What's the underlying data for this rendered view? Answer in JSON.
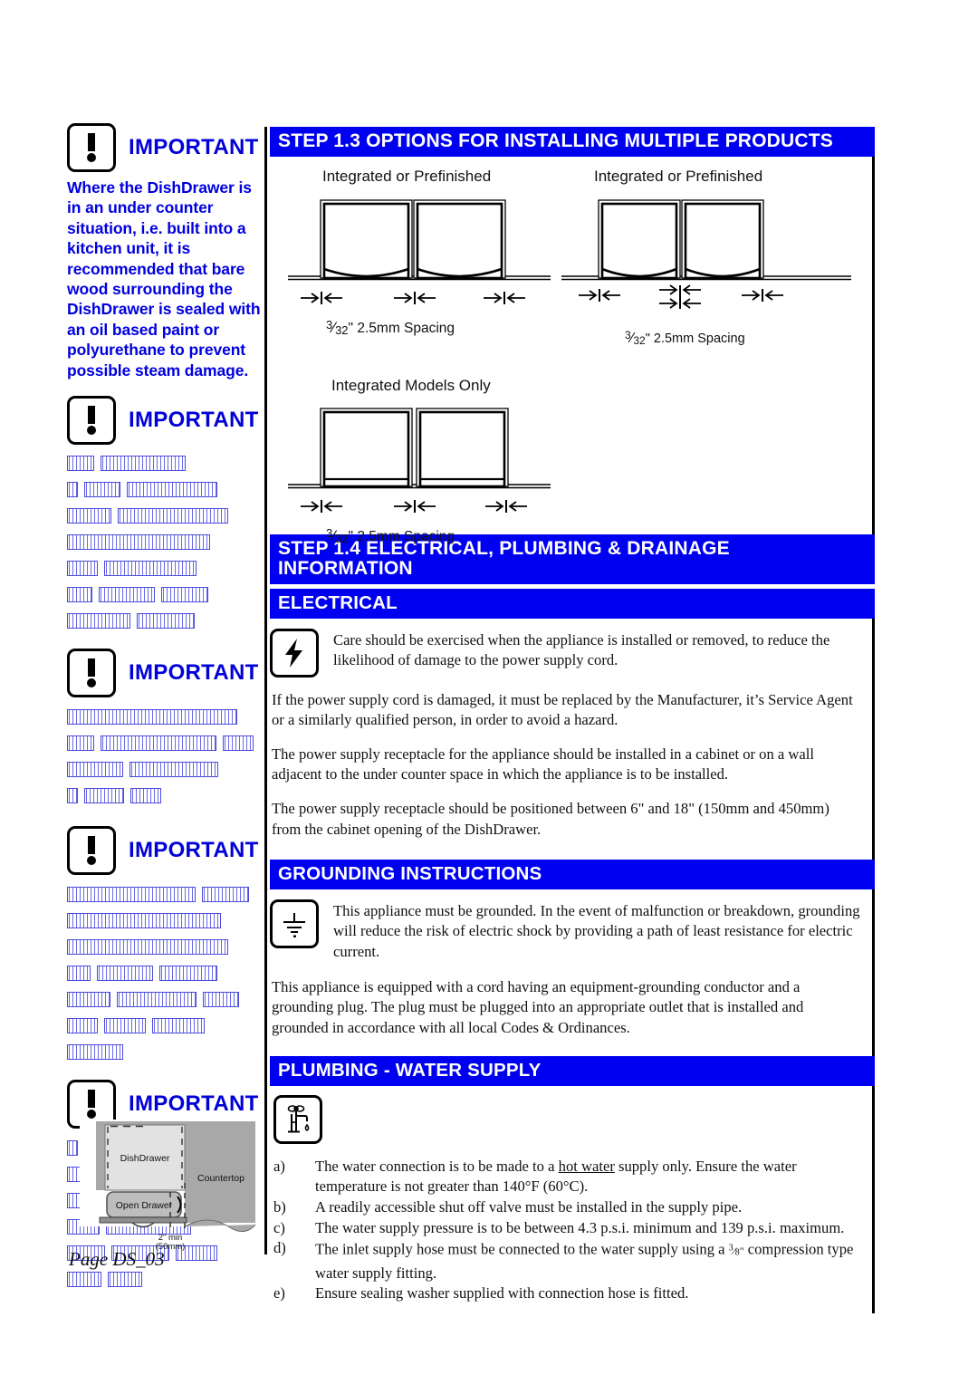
{
  "important_blocks": [
    {
      "icon": "exclamation-icon",
      "title": "IMPORTANT",
      "readable": true,
      "text": "Where the DishDrawer is in an under counter situation, i.e. built into a kitchen unit, it is recommended that bare wood surrounding the DishDrawer is sealed with an oil based paint or polyurethane to prevent possible steam damage."
    },
    {
      "icon": "exclamation-icon",
      "title": "IMPORTANT",
      "readable": false,
      "redacted_lines": [
        [
          28,
          92
        ],
        [
          10,
          38,
          98
        ],
        [
          47,
          120
        ],
        [
          156
        ],
        [
          32,
          100
        ],
        [
          26,
          60,
          50
        ],
        [
          68,
          62
        ]
      ]
    },
    {
      "icon": "exclamation-icon",
      "title": "IMPORTANT",
      "readable": false,
      "redacted_lines": [
        [
          186
        ],
        [
          28,
          126,
          32
        ],
        [
          60,
          96
        ],
        [
          10,
          42,
          32
        ]
      ]
    },
    {
      "icon": "exclamation-icon",
      "title": "IMPORTANT",
      "readable": false,
      "redacted_lines": [
        [
          140,
          50
        ],
        [
          168
        ],
        [
          176
        ],
        [
          24,
          60,
          62
        ],
        [
          46,
          86,
          38
        ],
        [
          32,
          44,
          56
        ],
        [
          60
        ]
      ]
    },
    {
      "icon": "exclamation-icon",
      "title": "IMPORTANT",
      "readable": false,
      "redacted_lines": [
        [
          10,
          148
        ],
        [
          168
        ],
        [
          66,
          12,
          34,
          34,
          22
        ],
        [
          34,
          92
        ],
        [
          40,
          62,
          44
        ],
        [
          36,
          36
        ]
      ]
    }
  ],
  "step_1_3": {
    "heading": "STEP  1.3  OPTIONS FOR INSTALLING MULTIPLE PRODUCTS",
    "diagram_a": {
      "label": "Integrated or Prefinished",
      "spacing_num": "3",
      "spacing_den": "32",
      "spacing_text": "\" 2.5mm Spacing"
    },
    "diagram_b": {
      "label": "Integrated or Prefinished",
      "spacing_num": "3",
      "spacing_den": "32",
      "spacing_text": "\" 2.5mm Spacing"
    },
    "diagram_c": {
      "label": "Integrated Models Only",
      "spacing_num": "3",
      "spacing_den": "32",
      "spacing_text": "\" 2.5mm Spacing"
    }
  },
  "step_1_4": {
    "heading": "STEP  1.4  ELECTRICAL, PLUMBING & DRAINAGE INFORMATION",
    "electrical": {
      "heading": "ELECTRICAL",
      "icon": "lightning-bolt-icon",
      "icon_paragraph": "Care should be exercised when the appliance is installed or removed, to reduce the likelihood of damage to the power supply cord.",
      "paragraphs": [
        "If the power supply cord is damaged, it must be replaced by the Manufacturer, it’s Service Agent or a similarly qualified person, in order to avoid a hazard.",
        "The power supply receptacle for the appliance should be installed in a cabinet or on a wall adjacent to the under counter space in which the appliance is to be installed.",
        "The power supply receptacle should be positioned between 6\" and 18\" (150mm and 450mm) from the cabinet opening of the DishDrawer."
      ]
    },
    "grounding": {
      "heading": "GROUNDING  INSTRUCTIONS",
      "icon": "earth-ground-icon",
      "icon_paragraph": "This appliance must be grounded.  In the event of malfunction or breakdown, grounding will reduce the risk of electric shock by providing a path of least resistance for electric current.",
      "paragraphs": [
        "This appliance is equipped with a cord having an equipment-grounding conductor and a grounding plug.  The plug must be plugged into an appropriate outlet that is installed and grounded in accordance with all local Codes & Ordinances."
      ]
    },
    "plumbing": {
      "heading": "PLUMBING  -  WATER  SUPPLY",
      "icon": "faucet-icon",
      "items": [
        {
          "marker": "a)",
          "pre": "The water connection is to be made to a ",
          "underline": "hot water",
          "post": " supply only.  Ensure the water temperature is not greater than 140°F (60°C)."
        },
        {
          "marker": "b)",
          "pre": "A readily accessible shut off valve must be installed in the supply pipe.",
          "underline": "",
          "post": ""
        },
        {
          "marker": "c)",
          "pre": "The water supply pressure is to be between 4.3 p.s.i.  minimum and 139 p.s.i. maximum.",
          "underline": "",
          "post": ""
        },
        {
          "marker": "d)",
          "pre": "The inlet supply hose must be connected to the water supply using a ",
          "underline": "",
          "post": " compression type water supply fitting.",
          "fraction": "3/8\""
        },
        {
          "marker": "e)",
          "pre": "Ensure sealing washer supplied with connection hose is fitted.",
          "underline": "",
          "post": ""
        }
      ]
    }
  },
  "bottom_diagram": {
    "dishdrawer_label": "DishDrawer",
    "countertop_label": "Countertop",
    "open_drawer_label": "Open Drawer",
    "dimension_line1": "2\" min",
    "dimension_line2": "(50mm)"
  },
  "page_number": "Page DS_03",
  "colors": {
    "accent_blue": "#0000f0",
    "text_blue": "#0000e0",
    "black": "#000000"
  }
}
